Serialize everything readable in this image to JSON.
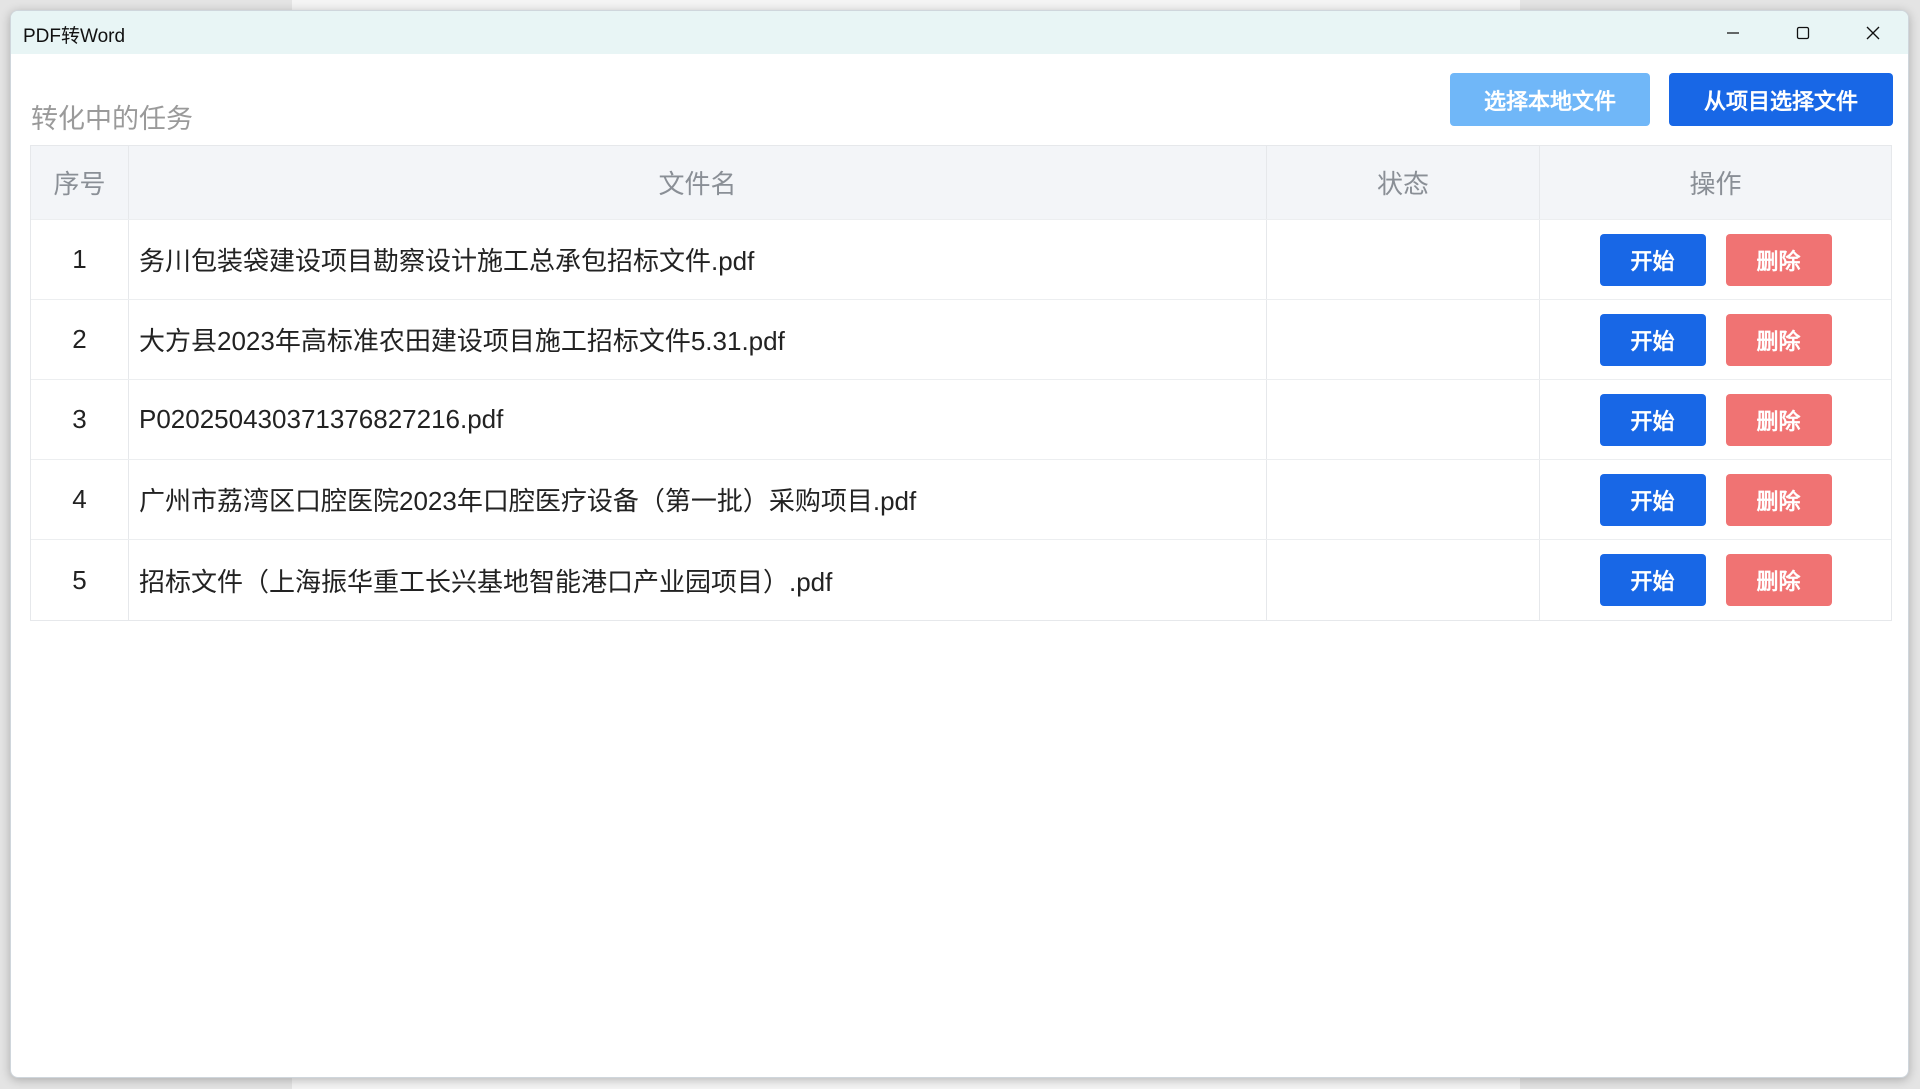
{
  "window": {
    "title": "PDF转Word"
  },
  "header": {
    "section_title": "转化中的任务",
    "select_local_label": "选择本地文件",
    "select_project_label": "从项目选择文件"
  },
  "table": {
    "columns": {
      "index": "序号",
      "filename": "文件名",
      "status": "状态",
      "operations": "操作"
    },
    "rows": [
      {
        "index": "1",
        "filename": "务川包装袋建设项目勘察设计施工总承包招标文件.pdf",
        "status": "",
        "start": "开始",
        "delete": "删除"
      },
      {
        "index": "2",
        "filename": "大方县2023年高标准农田建设项目施工招标文件5.31.pdf",
        "status": "",
        "start": "开始",
        "delete": "删除"
      },
      {
        "index": "3",
        "filename": "P020250430371376827216.pdf",
        "status": "",
        "start": "开始",
        "delete": "删除"
      },
      {
        "index": "4",
        "filename": "广州市荔湾区口腔医院2023年口腔医疗设备（第一批）采购项目.pdf",
        "status": "",
        "start": "开始",
        "delete": "删除"
      },
      {
        "index": "5",
        "filename": "招标文件（上海振华重工长兴基地智能港口产业园项目）.pdf",
        "status": "",
        "start": "开始",
        "delete": "删除"
      }
    ]
  },
  "colors": {
    "primary": "#1867e6",
    "primary_light": "#70b7f8",
    "danger": "#f07373",
    "titlebar_bg": "#e8f5f5"
  },
  "icons": {
    "minimize": "minimize-icon",
    "maximize": "maximize-icon",
    "close": "close-icon"
  }
}
